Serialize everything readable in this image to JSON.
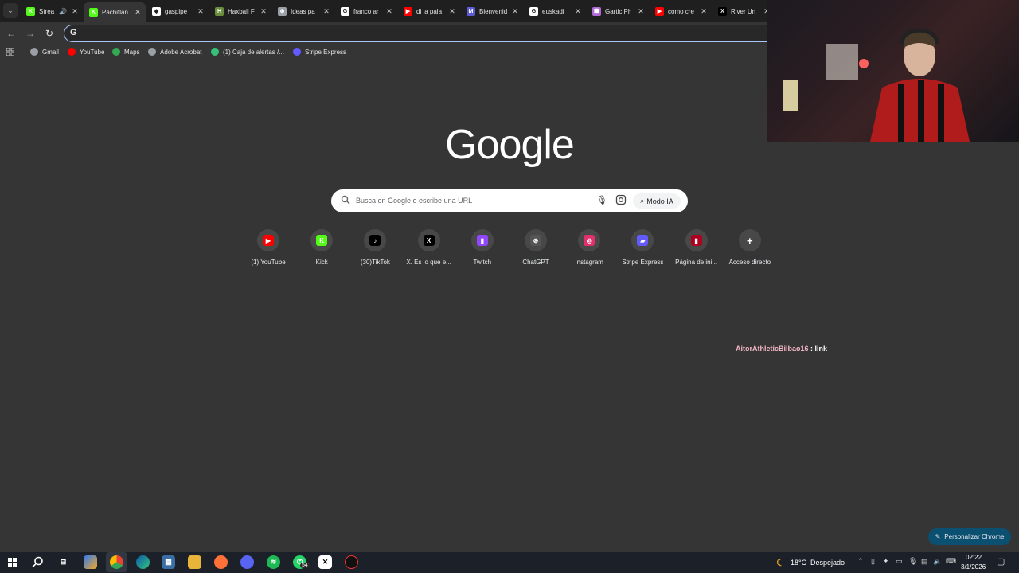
{
  "tabs": [
    {
      "title": "Strea",
      "icon": "kick-icon",
      "color": "#53fc18",
      "glyph": "K",
      "audio": true
    },
    {
      "title": "Pachiflan",
      "icon": "kick-icon",
      "color": "#53fc18",
      "glyph": "K"
    },
    {
      "title": "gaspipe",
      "icon": "diamond-icon",
      "color": "#ffffff",
      "glyph": "◆"
    },
    {
      "title": "Haxball F",
      "icon": "haxball-icon",
      "color": "#6b8e3c",
      "glyph": "H"
    },
    {
      "title": "Ideas pa",
      "icon": "chatgpt-icon",
      "color": "#9aa0a6",
      "glyph": "⊛"
    },
    {
      "title": "franco ar",
      "icon": "google-icon",
      "color": "#ffffff",
      "glyph": "G"
    },
    {
      "title": "di la pala",
      "icon": "youtube-icon",
      "color": "#ff0000",
      "glyph": "▶"
    },
    {
      "title": "Bienvenid",
      "icon": "mm-icon",
      "color": "#5b5bd6",
      "glyph": "M"
    },
    {
      "title": "euskadi",
      "icon": "google-icon",
      "color": "#ffffff",
      "glyph": "G"
    },
    {
      "title": "Gartic Ph",
      "icon": "gartic-icon",
      "color": "#b06ad6",
      "glyph": "☎"
    },
    {
      "title": "como cre",
      "icon": "youtube-icon",
      "color": "#ff0000",
      "glyph": "▶"
    },
    {
      "title": "River Un",
      "icon": "x-icon",
      "color": "#000000",
      "glyph": "X"
    }
  ],
  "bookmarks": [
    {
      "label": "Gmail",
      "color": "#9aa0a6"
    },
    {
      "label": "YouTube",
      "color": "#ff0000"
    },
    {
      "label": "Maps",
      "color": "#34a853"
    },
    {
      "label": "Adobe Acrobat",
      "color": "#9aa0a6"
    },
    {
      "label": "(1) Caja de alertas /...",
      "color": "#36c07a"
    },
    {
      "label": "Stripe Express",
      "color": "#635bff"
    }
  ],
  "google": {
    "logo": "Google",
    "search_placeholder": "Busca en Google o escribe una URL",
    "ai_mode": "Modo IA"
  },
  "shortcuts": [
    {
      "label": "(1) YouTube",
      "color": "#ff0000",
      "glyph": "▶"
    },
    {
      "label": "Kick",
      "color": "#53fc18",
      "glyph": "K"
    },
    {
      "label": "(30)TikTok",
      "color": "#000000",
      "glyph": "♪"
    },
    {
      "label": "X. Es lo que e...",
      "color": "#000000",
      "glyph": "X"
    },
    {
      "label": "Twitch",
      "color": "#9146ff",
      "glyph": "▮"
    },
    {
      "label": "ChatGPT",
      "color": "#555555",
      "glyph": "⊛"
    },
    {
      "label": "Instagram",
      "color": "#e1306c",
      "glyph": "◎"
    },
    {
      "label": "Stripe Express",
      "color": "#635bff",
      "glyph": "▰"
    },
    {
      "label": "Página de ini...",
      "color": "#b00020",
      "glyph": "▮"
    },
    {
      "label": "Acceso directo",
      "color": "#484848",
      "glyph": "+"
    }
  ],
  "overlay": {
    "user": "AitorAthleticBilbao16",
    "message": " : link",
    "user_color": "#f4b6c8"
  },
  "customize_label": "Personalizar Chrome",
  "weather": {
    "temp": "18°C",
    "desc": "Despejado"
  },
  "clock": {
    "time": "02:22",
    "date": "3/1/2026"
  },
  "whatsapp_badge": "54"
}
